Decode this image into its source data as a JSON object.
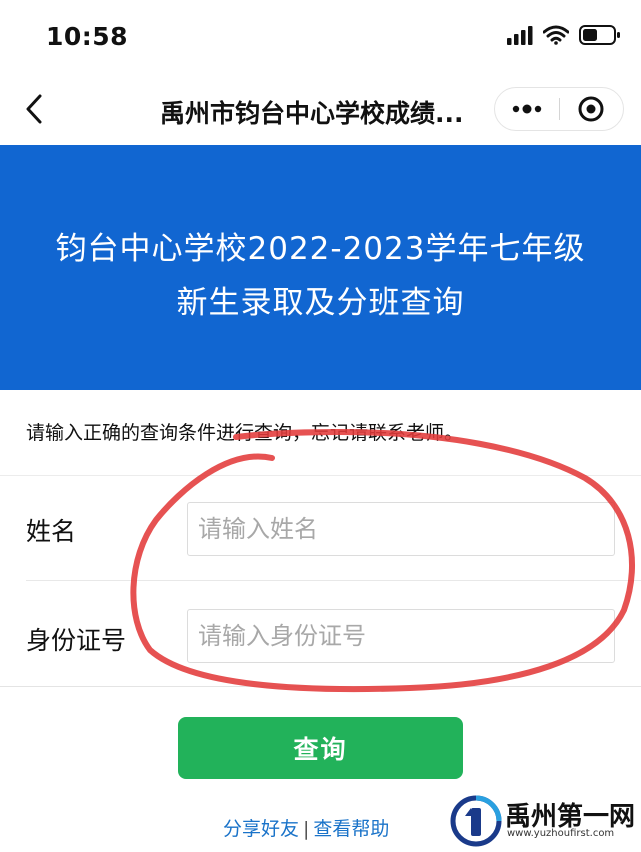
{
  "status_bar": {
    "time": "10:58",
    "icons": [
      "signal-icon",
      "wifi-icon",
      "battery-icon"
    ]
  },
  "nav": {
    "title": "禹州市钧台中心学校成绩...",
    "icons": [
      "back-icon",
      "more-icon",
      "close-icon"
    ]
  },
  "banner": {
    "line1": "钧台中心学校2022-2023学年七年级",
    "line2": "新生录取及分班查询",
    "bg_color": "#1166d1"
  },
  "notice": "请输入正确的查询条件进行查询，忘记请联系老师。",
  "form": {
    "fields": [
      {
        "label": "姓名",
        "placeholder": "请输入姓名",
        "value": ""
      },
      {
        "label": "身份证号",
        "placeholder": "请输入身份证号",
        "value": ""
      }
    ]
  },
  "submit": {
    "label": "查询",
    "color": "#22b25a"
  },
  "links": {
    "share": "分享好友",
    "separator": "|",
    "help": "查看帮助"
  },
  "annotation": {
    "color": "#e23a3a"
  },
  "watermark": {
    "name": "禹州第一网",
    "url": "www.yuzhoufirst.com",
    "icon": "logo-icon"
  }
}
